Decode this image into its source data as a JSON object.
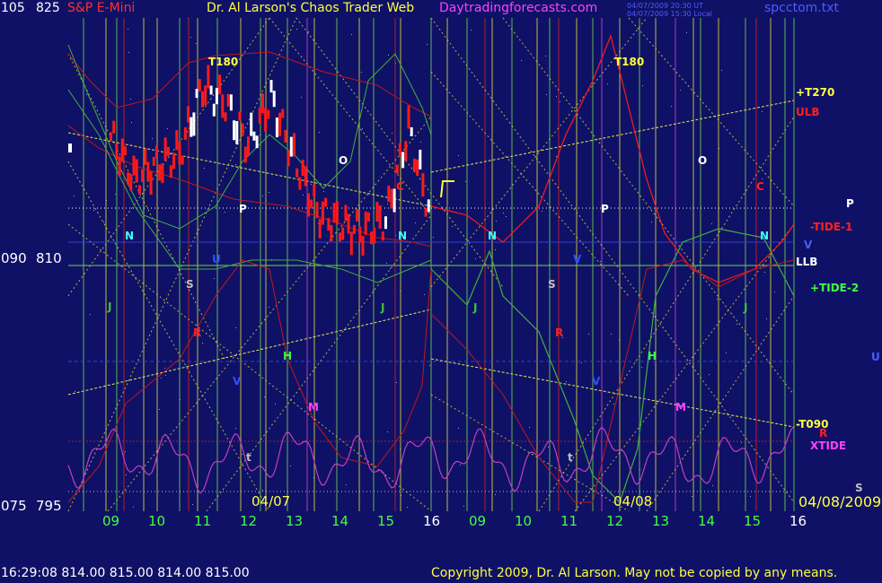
{
  "header": {
    "left_y_top": "105",
    "left_price_top": "825",
    "symbol": "S&P E-Mini",
    "title": "Dr. Al Larson's Chaos Trader Web",
    "site": "Daytradingforecasts.com",
    "stamp_line1": "04/07/2009 20:30 UT",
    "stamp_line2": "04/07/2009 15:30 Local",
    "file": "spcctom.txt"
  },
  "axis": {
    "left_y_mid": "090",
    "left_price_mid": "810",
    "left_y_bottom": "075",
    "left_price_bottom": "795",
    "price_range": [
      795,
      825
    ],
    "hours": [
      "09",
      "10",
      "11",
      "12",
      "13",
      "14",
      "15",
      "16",
      "09",
      "10",
      "11",
      "12",
      "13",
      "14",
      "15",
      "16"
    ],
    "date_labels": [
      "04/07",
      "04/08",
      "04/08/2009"
    ]
  },
  "right_labels": [
    "+T270",
    "ULB",
    "P",
    "-TIDE-1",
    "V",
    "LLB",
    "+TIDE-2",
    "U",
    "-T090",
    "R",
    "XTIDE",
    "S"
  ],
  "chart_labels": {
    "t180": "T180",
    "letters": [
      "N",
      "U",
      "J",
      "S",
      "R",
      "H",
      "V",
      "M",
      "t",
      "P",
      "O",
      "C",
      "N",
      "J",
      "N",
      "J",
      "S",
      "R",
      "H",
      "V",
      "M",
      "t",
      "P",
      "O",
      "C",
      "N",
      "J",
      "V"
    ]
  },
  "footer": {
    "quote": "16:29:08  814.00 815.00 814.00 815.00",
    "copyright": "Copyright 2009, Dr. Al Larson. May not be copied by any means."
  },
  "colors": {
    "background": "#0f1166",
    "grid_green": "#6fd24b",
    "grid_yellow": "#d8d840",
    "grid_magenta": "#d040d0",
    "grid_red": "#d02020",
    "price_red": "#ff1a1a",
    "price_white": "#ffffff",
    "band_red": "#c01818",
    "band_green": "#40b040",
    "tide": "#c040c0",
    "yellow_line": "#e8e850",
    "title_yellow": "#ffff40",
    "site_magenta": "#ff40ff",
    "footer_yellow": "#ffff40"
  },
  "chart_data": {
    "type": "line",
    "title": "S&P E-Mini",
    "y_range": [
      795,
      825
    ],
    "series": [
      {
        "name": "price",
        "x": [
          9.0,
          9.5,
          10.0,
          10.5,
          11.0,
          11.5,
          12.0,
          12.5,
          13.0,
          13.5,
          14.0,
          14.5,
          15.0,
          15.5,
          16.0
        ],
        "values": [
          817.5,
          815.0,
          815.8,
          816.5,
          820.5,
          819.5,
          817.0,
          819.8,
          816.2,
          813.0,
          812.2,
          811.8,
          812.5,
          818.0,
          812.5
        ]
      },
      {
        "name": "ULB"
      },
      {
        "name": "LLB"
      },
      {
        "name": "XTIDE"
      }
    ]
  }
}
